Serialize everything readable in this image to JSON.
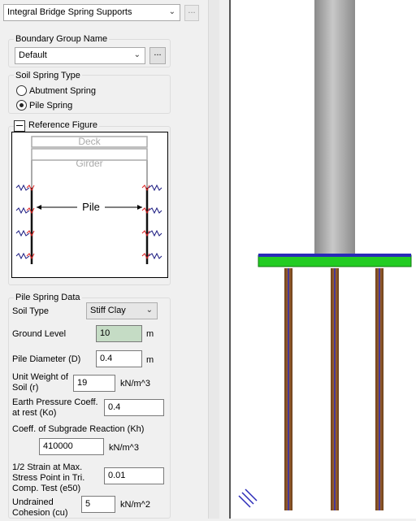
{
  "header": {
    "dropdown_value": "Integral Bridge Spring Supports",
    "more_label": "..."
  },
  "boundary_group": {
    "title": "Boundary Group Name",
    "value": "Default",
    "more_label": "..."
  },
  "spring_type": {
    "title": "Soil Spring Type",
    "options": [
      "Abutment Spring",
      "Pile Spring"
    ],
    "selected": "Pile Spring"
  },
  "reference_figure": {
    "title": "Reference Figure",
    "deck": "Deck",
    "girder": "Girder",
    "pile": "Pile"
  },
  "pile_data": {
    "title": "Pile Spring Data",
    "soil_type_label": "Soil Type",
    "soil_type_value": "Stiff Clay",
    "ground_level_label": "Ground Level",
    "ground_level_value": "10",
    "ground_level_unit": "m",
    "diameter_label": "Pile Diameter (D)",
    "diameter_value": "0.4",
    "diameter_unit": "m",
    "unit_weight_label_1": "Unit Weight of",
    "unit_weight_label_2": "Soil (r)",
    "unit_weight_value": "19",
    "unit_weight_unit": "kN/m^3",
    "earth_pressure_label_1": "Earth Pressure Coeff.",
    "earth_pressure_label_2": "at rest (Ko)",
    "earth_pressure_value": "0.4",
    "subgrade_label": "Coeff. of Subgrade Reaction (Kh)",
    "subgrade_value": "410000",
    "subgrade_unit": "kN/m^3",
    "strain_label_1": "1/2 Strain at Max.",
    "strain_label_2": "Stress Point in Tri.",
    "strain_label_3": "Comp. Test (e50)",
    "strain_value": "0.01",
    "cohesion_label_1": "Undrained",
    "cohesion_label_2": "Cohesion (cu)",
    "cohesion_value": "5",
    "cohesion_unit": "kN/m^2"
  },
  "colors": {
    "ground_level_bg": "#c5dcc5",
    "pile": "#8b5a2b",
    "spring": "#2a2ab8",
    "cap": "#22cc22",
    "column": "#a8a8a8"
  }
}
